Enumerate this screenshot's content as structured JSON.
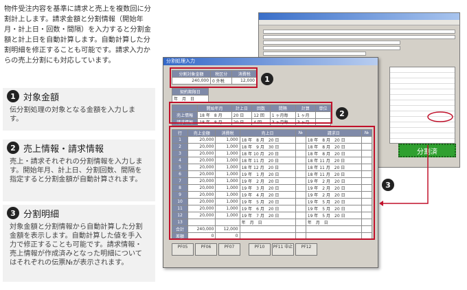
{
  "intro": "物件受注内容を基準に請求と売上を複数回に分割計上します。請求金額と分割情報（開始年月・計上日・回数・間隔）を入力すると分割金額と計上日を自動計算します。自動計算した分割明細を修正することも可能です。請求入力からの売上分割にも対応しています。",
  "cards": [
    {
      "num": "1",
      "title": "対象金額",
      "body": "伝分割処理の対象となる金額を入力します。"
    },
    {
      "num": "2",
      "title": "売上情報・請求情報",
      "body": "売上・請求それぞれの分割情報を入力します。開始年月、計上日、分割回数、間隔を指定すると分割金額が自動計算されます。"
    },
    {
      "num": "3",
      "title": "分割明細",
      "body": "対象金額と分割情報から自動計算した分割金額を表示します。自動計算した値を手入力で修正することも可能です。請求情報・売上情報が作成済みとなった明細についてはそれぞれの伝票№が表示されます。"
    }
  ],
  "dialog": {
    "title": "分割処理入力",
    "amount_headers": [
      "分割対象金額",
      "税区分",
      "消費税"
    ],
    "amount_values": [
      "240,000",
      "0 外税",
      "12,000"
    ],
    "date_label": "契約期限日",
    "date_value": "年　月　日",
    "info_headers": [
      "",
      "開始年月",
      "計上日",
      "回数",
      "間隔",
      "計算",
      "単位"
    ],
    "info_rows": [
      [
        "売上情報",
        "18 年　8 月",
        "20 日",
        "12 回",
        "1 ヶ月毎",
        "1 ヶ月"
      ],
      [
        "請求情報",
        "18 年　8 月",
        "20 日",
        "4 回",
        "3 ヶ月毎",
        "3 ヶ月"
      ]
    ],
    "detail_headers": [
      "行",
      "売上金額",
      "消費税",
      "売上日",
      "№",
      "請求日",
      "№"
    ],
    "detail_rows": [
      [
        "1",
        "20,000",
        "1,000",
        "18 年　8 月　20 日",
        "18 年　8 月　20 日"
      ],
      [
        "2",
        "20,000",
        "1,000",
        "18 年　9 月　30 日",
        "18 年　8 月　20 日"
      ],
      [
        "3",
        "20,000",
        "1,000",
        "18 年 10 月　20 日",
        "18 年　8 月　20 日"
      ],
      [
        "4",
        "20,000",
        "1,000",
        "18 年 11 月　20 日",
        "18 年 11 月　20 日"
      ],
      [
        "5",
        "20,000",
        "1,000",
        "18 年 12 月　20 日",
        "18 年 11 月　20 日"
      ],
      [
        "6",
        "20,000",
        "1,000",
        "19 年　1 月　20 日",
        "18 年 11 月　20 日"
      ],
      [
        "7",
        "20,000",
        "1,000",
        "19 年　2 月　20 日",
        "19 年　2 月　20 日"
      ],
      [
        "8",
        "20,000",
        "1,000",
        "19 年　3 月　20 日",
        "19 年　2 月　20 日"
      ],
      [
        "9",
        "20,000",
        "1,000",
        "19 年　4 月　20 日",
        "19 年　2 月　20 日"
      ],
      [
        "10",
        "20,000",
        "1,000",
        "19 年　5 月　20 日",
        "19 年　5 月　20 日"
      ],
      [
        "11",
        "20,000",
        "1,000",
        "19 年　6 月　20 日",
        "19 年　5 月　20 日"
      ],
      [
        "12",
        "20,000",
        "1,000",
        "19 年　7 月　20 日",
        "19 年　5 月　20 日"
      ],
      [
        "13",
        "",
        "",
        "年　月　日",
        "年　月　日"
      ]
    ],
    "total_label": "合計",
    "total_amount": "240,000",
    "total_tax": "12,000",
    "diff_label": "差額",
    "diff_amount": "0",
    "diff_tax": "0",
    "fkeys": [
      "PF05",
      "PF06",
      "PF07",
      "PF10",
      "PF11 中止",
      "PF12"
    ]
  },
  "bunkatsu_label": "分割済"
}
